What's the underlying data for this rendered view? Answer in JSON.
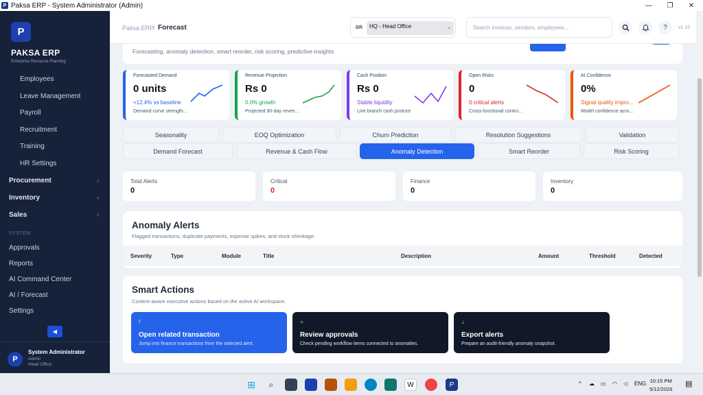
{
  "window": {
    "title": "Paksa ERP - System Administrator (Admin)",
    "app_icon_letter": "P",
    "controls": [
      "—",
      "❐",
      "✕"
    ]
  },
  "sidebar": {
    "logo_letter": "P",
    "brand": "PAKSA ERP",
    "brand_sub": "Enterprise Resource Planning",
    "hr_items": [
      "Employees",
      "Leave Management",
      "Payroll",
      "Recruitment",
      "Training",
      "HR Settings"
    ],
    "groups": [
      "Procurement",
      "Inventory",
      "Sales"
    ],
    "system_heading": "SYSTEM",
    "system_items": [
      "Approvals",
      "Reports",
      "AI Command Center",
      "AI / Forecast",
      "Settings"
    ],
    "collapse_icon": "◀",
    "user": {
      "initial": "P",
      "name": "System Administrator",
      "role": "Admin",
      "office": "Head Office"
    }
  },
  "topbar": {
    "breadcrumb_root": "Paksa ERP",
    "breadcrumb_sep": "/",
    "breadcrumb_current": "Forecast",
    "branch_code": "BR",
    "branch_selected": "HQ - Head Office",
    "search_placeholder": "Search invoices, vendors, employees...",
    "icons": [
      "search-icon",
      "bell-icon",
      "help-icon"
    ],
    "help_glyph": "?",
    "version": "v1.10"
  },
  "hero": {
    "description": "Forecasting, anomaly detection, smart reorder, risk scoring, predictive insights"
  },
  "kpis": [
    {
      "label": "Forecasted Demand",
      "value": "0 units",
      "trend": "+12.4% vs baseline",
      "foot": "Demand curve strength...",
      "color": "#2563eb"
    },
    {
      "label": "Revenue Projection",
      "value": "Rs 0",
      "trend": "0.0% growth",
      "foot": "Projected 90-day reven...",
      "color": "#16a34a"
    },
    {
      "label": "Cash Position",
      "value": "Rs 0",
      "trend": "Stable liquidity",
      "foot": "Live branch cash posture",
      "color": "#7c3aed"
    },
    {
      "label": "Open Risks",
      "value": "0",
      "trend": "0 critical alerts",
      "foot": "Cross-functional contro...",
      "color": "#dc2626"
    },
    {
      "label": "AI Confidence",
      "value": "0%",
      "trend": "Signal quality impro...",
      "foot": "Model confidence acro...",
      "color": "#ea580c"
    }
  ],
  "tabs_row1": [
    "Seasonality",
    "EOQ Optimization",
    "Churn Prediction",
    "Resolution Suggestions",
    "Validation"
  ],
  "tabs_row2": [
    "Demand Forecast",
    "Revenue & Cash Flow",
    "Anomaly Detection",
    "Smart Reorder",
    "Risk Scoring"
  ],
  "active_tab": "Anomaly Detection",
  "stats": [
    {
      "label": "Total Alerts",
      "value": "0"
    },
    {
      "label": "Critical",
      "value": "0"
    },
    {
      "label": "Finance",
      "value": "0"
    },
    {
      "label": "Inventory",
      "value": "0"
    }
  ],
  "anomaly": {
    "title": "Anomaly Alerts",
    "description": "Flagged transactions, duplicate payments, expense spikes, and stock shrinkage.",
    "columns": [
      "Severity",
      "Type",
      "Module",
      "Title",
      "Description",
      "Amount",
      "Threshold",
      "Detected"
    ]
  },
  "smart_actions": {
    "title": "Smart Actions",
    "description": "Context-aware executive actions based on the active AI workspace.",
    "items": [
      {
        "icon": "!",
        "title": "Open related transaction",
        "desc": "Jump into finance transactions from the selected alert."
      },
      {
        "icon": "○",
        "title": "Review approvals",
        "desc": "Check pending workflow items connected to anomalies."
      },
      {
        "icon": "↓",
        "title": "Export alerts",
        "desc": "Prepare an audit-friendly anomaly snapshot."
      }
    ]
  },
  "taskbar": {
    "lang": "ENG",
    "time": "10:15 PM",
    "date": "5/12/2026",
    "tray_chevron": "^"
  }
}
